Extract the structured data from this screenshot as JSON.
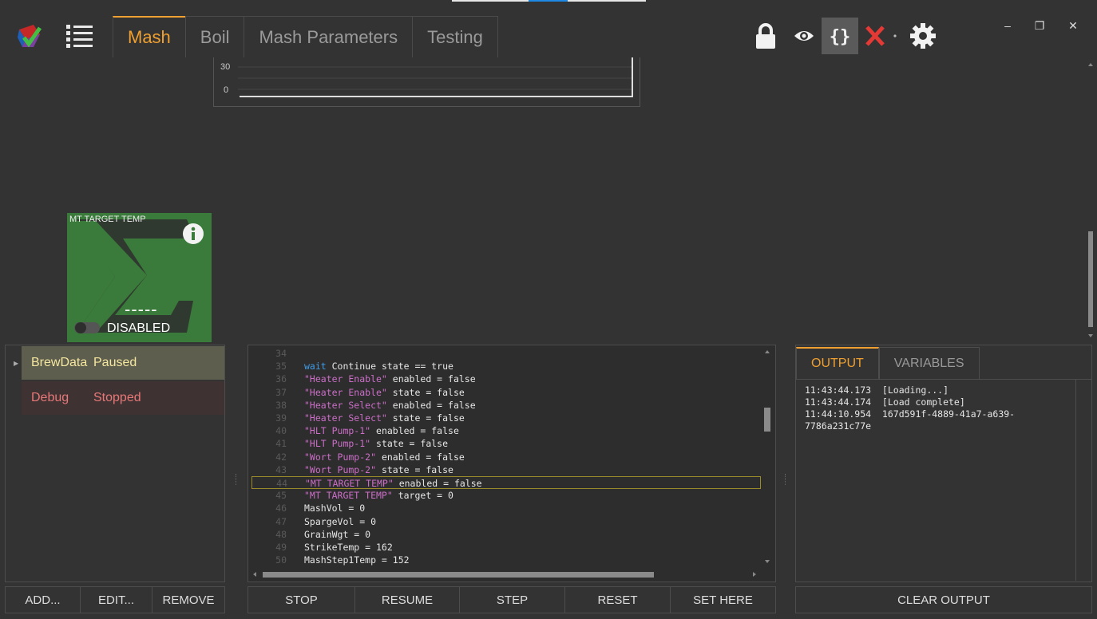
{
  "tabs": [
    {
      "label": "Mash",
      "active": true
    },
    {
      "label": "Boil",
      "active": false
    },
    {
      "label": "Mash Parameters",
      "active": false
    },
    {
      "label": "Testing",
      "active": false
    }
  ],
  "toolbar": {
    "icons": [
      "lock-icon",
      "eye-icon",
      "braces-icon",
      "close-x-icon",
      "gear-icon"
    ],
    "accent": "#f0a030",
    "close_color": "#e53935"
  },
  "window": {
    "minimize": "–",
    "restore": "❐",
    "close": "✕"
  },
  "chart": {
    "y_ticks": [
      "30",
      "0"
    ]
  },
  "widget": {
    "title": "MT TARGET TEMP",
    "value": "-----",
    "status": "DISABLED",
    "color": "#3a7a3a"
  },
  "scripts": [
    {
      "name": "BrewData",
      "state": "Paused"
    },
    {
      "name": "Debug",
      "state": "Stopped"
    }
  ],
  "script_buttons": {
    "add": "ADD...",
    "edit": "EDIT...",
    "remove": "REMOVE"
  },
  "code": {
    "lines": [
      {
        "n": "34",
        "parts": []
      },
      {
        "n": "35",
        "parts": [
          {
            "t": "wait",
            "c": "kw"
          },
          {
            "t": " Continue state == true",
            "c": ""
          }
        ]
      },
      {
        "n": "36",
        "parts": [
          {
            "t": "\"Heater Enable\"",
            "c": "str"
          },
          {
            "t": " enabled = false",
            "c": ""
          }
        ]
      },
      {
        "n": "37",
        "parts": [
          {
            "t": "\"Heater Enable\"",
            "c": "str"
          },
          {
            "t": " state = false",
            "c": ""
          }
        ]
      },
      {
        "n": "38",
        "parts": [
          {
            "t": "\"Heater Select\"",
            "c": "str"
          },
          {
            "t": " enabled = false",
            "c": ""
          }
        ]
      },
      {
        "n": "39",
        "parts": [
          {
            "t": "\"Heater Select\"",
            "c": "str"
          },
          {
            "t": " state = false",
            "c": ""
          }
        ]
      },
      {
        "n": "40",
        "parts": [
          {
            "t": "\"HLT Pump-1\"",
            "c": "str"
          },
          {
            "t": " enabled = false",
            "c": ""
          }
        ]
      },
      {
        "n": "41",
        "parts": [
          {
            "t": "\"HLT Pump-1\"",
            "c": "str"
          },
          {
            "t": " state = false",
            "c": ""
          }
        ]
      },
      {
        "n": "42",
        "parts": [
          {
            "t": "\"Wort Pump-2\"",
            "c": "str"
          },
          {
            "t": " enabled = false",
            "c": ""
          }
        ]
      },
      {
        "n": "43",
        "parts": [
          {
            "t": "\"Wort Pump-2\"",
            "c": "str"
          },
          {
            "t": " state = false",
            "c": ""
          }
        ]
      },
      {
        "n": "44",
        "parts": [
          {
            "t": "\"MT TARGET TEMP\"",
            "c": "str"
          },
          {
            "t": " enabled = false",
            "c": ""
          }
        ],
        "hl": true
      },
      {
        "n": "45",
        "parts": [
          {
            "t": "\"MT TARGET TEMP\"",
            "c": "str"
          },
          {
            "t": " target = 0",
            "c": ""
          }
        ]
      },
      {
        "n": "46",
        "parts": [
          {
            "t": "MashVol = 0",
            "c": ""
          }
        ]
      },
      {
        "n": "47",
        "parts": [
          {
            "t": "SpargeVol = 0",
            "c": ""
          }
        ]
      },
      {
        "n": "48",
        "parts": [
          {
            "t": "GrainWgt = 0",
            "c": ""
          }
        ]
      },
      {
        "n": "49",
        "parts": [
          {
            "t": "StrikeTemp = 162",
            "c": ""
          }
        ]
      },
      {
        "n": "50",
        "parts": [
          {
            "t": "MashStep1Temp = 152",
            "c": ""
          }
        ]
      }
    ]
  },
  "debug_buttons": {
    "stop": "STOP",
    "resume": "RESUME",
    "step": "STEP",
    "reset": "RESET",
    "set_here": "SET HERE"
  },
  "output": {
    "tabs": [
      {
        "label": "OUTPUT",
        "active": true
      },
      {
        "label": "VARIABLES",
        "active": false
      }
    ],
    "lines": [
      "11:43:44.173  [Loading...]",
      "11:43:44.174  [Load complete]",
      "11:44:10.954  167d591f-4889-41a7-a639-",
      "7786a231c77e"
    ],
    "clear": "CLEAR OUTPUT"
  }
}
